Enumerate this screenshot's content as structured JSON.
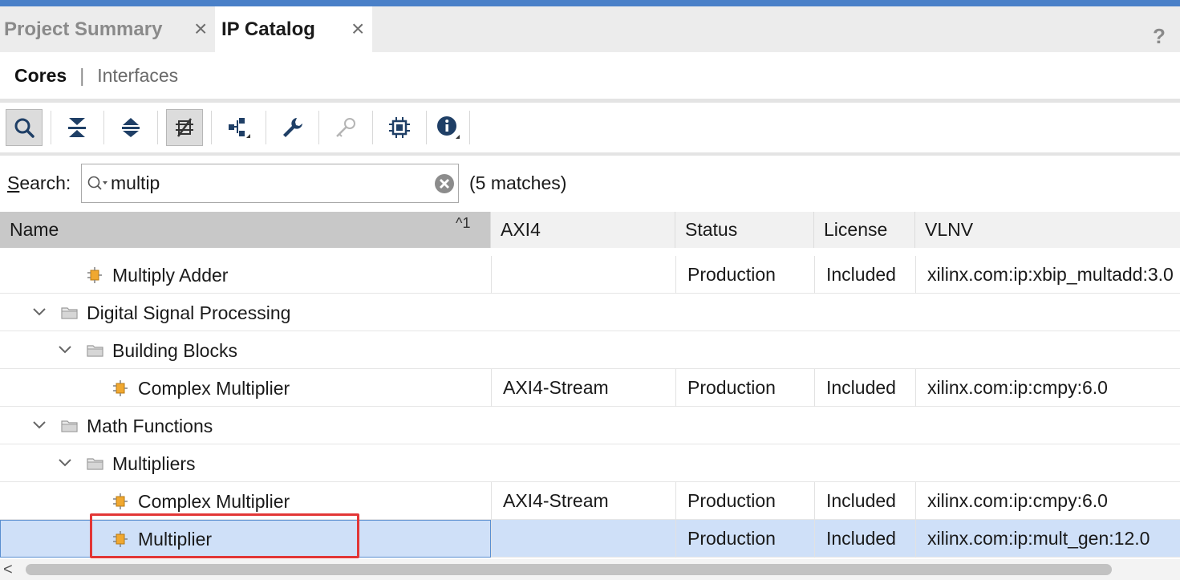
{
  "tabs": [
    {
      "label": "Project Summary",
      "active": false
    },
    {
      "label": "IP Catalog",
      "active": true
    }
  ],
  "help_label": "?",
  "subtabs": {
    "cores": "Cores",
    "separator": "|",
    "interfaces": "Interfaces"
  },
  "toolbar": {
    "buttons": [
      "search-icon",
      "collapse-all-icon",
      "expand-all-icon",
      "filter-icon",
      "hierarchy-icon",
      "wrench-icon",
      "key-icon",
      "chip-icon",
      "info-icon"
    ]
  },
  "search": {
    "label_prefix": "S",
    "label_rest": "earch:",
    "value": "multip",
    "matches": "(5 matches)"
  },
  "columns": {
    "name": "Name",
    "sort_indicator": "^1",
    "axi4": "AXI4",
    "status": "Status",
    "license": "License",
    "vlnv": "VLNV"
  },
  "rows": [
    {
      "type": "ip",
      "level": 2,
      "name": "Multiply Adder",
      "axi4": "",
      "status": "Production",
      "license": "Included",
      "vlnv": "xilinx.com:ip:xbip_multadd:3.0",
      "selected": false
    },
    {
      "type": "folder",
      "level": 0,
      "name": "Digital Signal Processing"
    },
    {
      "type": "folder",
      "level": 1,
      "name": "Building Blocks"
    },
    {
      "type": "ip",
      "level": 3,
      "name": "Complex Multiplier",
      "axi4": "AXI4-Stream",
      "status": "Production",
      "license": "Included",
      "vlnv": "xilinx.com:ip:cmpy:6.0",
      "selected": false
    },
    {
      "type": "folder",
      "level": 0,
      "name": "Math Functions"
    },
    {
      "type": "folder",
      "level": 1,
      "name": "Multipliers"
    },
    {
      "type": "ip",
      "level": 3,
      "name": "Complex Multiplier",
      "axi4": "AXI4-Stream",
      "status": "Production",
      "license": "Included",
      "vlnv": "xilinx.com:ip:cmpy:6.0",
      "selected": false
    },
    {
      "type": "ip",
      "level": 3,
      "name": "Multiplier",
      "axi4": "",
      "status": "Production",
      "license": "Included",
      "vlnv": "xilinx.com:ip:mult_gen:12.0",
      "selected": true
    }
  ],
  "colors": {
    "accent": "#4a80c8",
    "selected_row": "#cfe0f8",
    "highlight": "#e23636",
    "ip_icon": "#f0a830"
  }
}
